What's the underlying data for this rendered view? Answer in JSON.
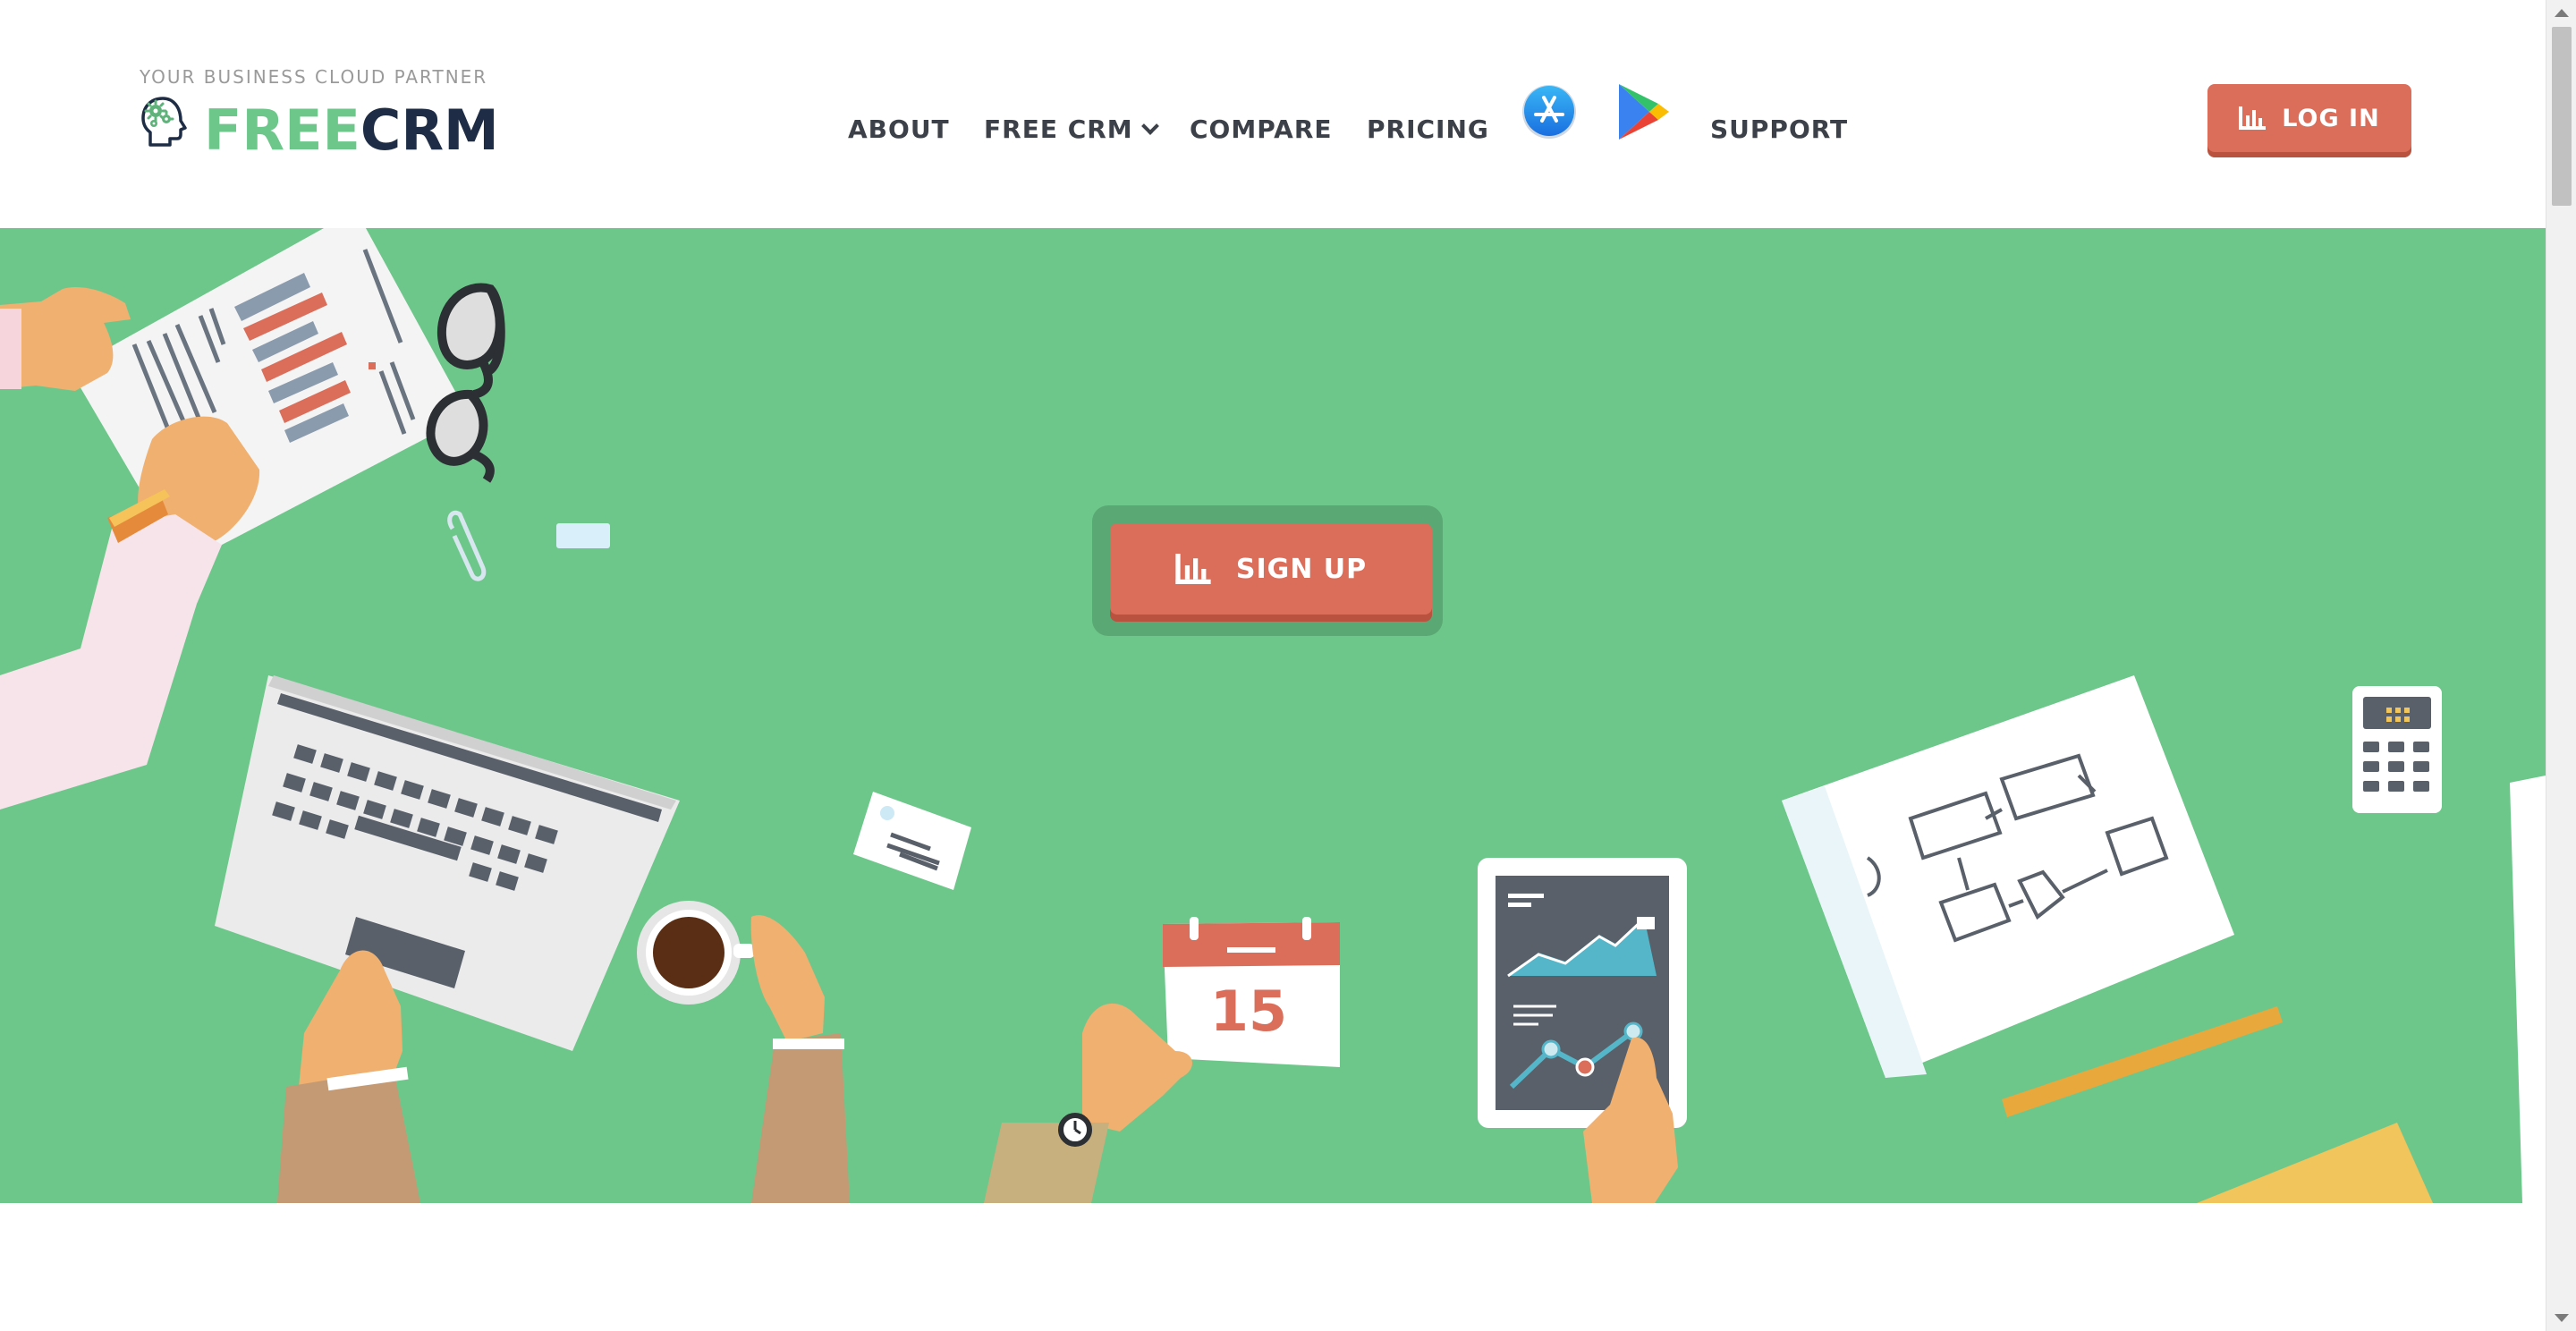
{
  "brand": {
    "tagline": "YOUR BUSINESS CLOUD PARTNER",
    "logo_free": "FREE",
    "logo_crm": "CRM"
  },
  "nav": {
    "items": [
      {
        "label": "ABOUT"
      },
      {
        "label": "FREE CRM",
        "has_dropdown": true
      },
      {
        "label": "COMPARE"
      },
      {
        "label": "PRICING"
      },
      {
        "label": "SUPPORT"
      }
    ],
    "store_icons": [
      "app-store-icon",
      "google-play-icon"
    ]
  },
  "header": {
    "login_label": "LOG IN",
    "login_icon": "bar-chart-icon"
  },
  "hero": {
    "signup_label": "SIGN UP",
    "signup_icon": "bar-chart-icon",
    "calendar_day": "15"
  },
  "colors": {
    "brand_green": "#6dc78b",
    "brand_navy": "#1e2d45",
    "accent_red": "#db6e5b",
    "hero_bg": "#6ec78a"
  }
}
